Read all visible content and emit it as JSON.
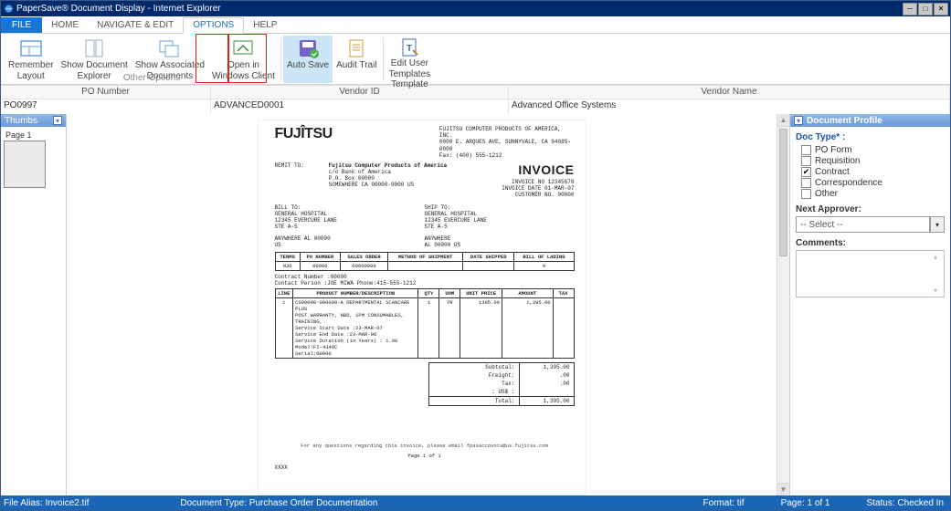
{
  "window": {
    "title": "PaperSave® Document Display - Internet Explorer"
  },
  "tabs": {
    "file": "FILE",
    "home": "HOME",
    "nav": "NAVIGATE & EDIT",
    "options": "OPTIONS",
    "help": "HELP"
  },
  "ribbon": {
    "remember_layout": "Remember\nLayout",
    "show_doc_explorer": "Show Document\nExplorer",
    "show_assoc": "Show Associated\nDocuments",
    "open_win": "Open in\nWindows Client",
    "auto_save": "Auto Save",
    "audit_trail": "Audit Trail",
    "edit_user": "Edit User\nTemplates\nTemplate",
    "other_options": "Other Options"
  },
  "header": {
    "po_label": "PO Number",
    "vid_label": "Vendor ID",
    "vname_label": "Vendor Name",
    "po": "PO0997",
    "vid": "ADVANCED0001",
    "vname": "Advanced Office Systems"
  },
  "thumbs": {
    "title": "Thumbs",
    "page1": "Page 1"
  },
  "profile": {
    "title": "Document Profile",
    "doc_type_label": "Doc Type* :",
    "opts": {
      "po_form": "PO Form",
      "requisition": "Requisition",
      "contract": "Contract",
      "correspondence": "Correspondence",
      "other": "Other"
    },
    "next_approver_label": "Next Approver:",
    "next_approver_value": "-- Select --",
    "comments_label": "Comments:"
  },
  "status": {
    "alias": "File Alias: Invoice2.tif",
    "doc_type": "Document Type: Purchase Order Documentation",
    "format": "Format: tif",
    "page": "Page: 1 of 1",
    "state": "Status: Checked In"
  },
  "invoice": {
    "company_line1": "FUJITSU COMPUTER PRODUCTS OF AMERICA, INC.",
    "company_line2": "0000 E. ARQUES AVE, SUNNYVALE, CA 94085-0000",
    "fax": "Fax: (408) 555-1212",
    "remit_label": "REMIT TO:",
    "remit1": "Fujitsu Computer Products of America",
    "remit2": "c/o Bank of America",
    "remit3": "P.O. Box 00000",
    "remit4": "SOMEWHERE CA 00000-0000 US",
    "invoice_word": "INVOICE",
    "invoice_no": "INVOICE NO  12345678",
    "invoice_date": "INVOICE DATE 01-MAR-07",
    "customer_no": "CUSTOMER NO. 00000",
    "billto_label": "BILL TO:",
    "shipto_label": "SHIP TO:",
    "bill1": "GENERAL HOSPITAL",
    "bill2": "12345 EVERCURE LANE",
    "bill3": "STE A-5",
    "bill4": "ANYWHERE AL 00000",
    "bill5": "US",
    "ship1": "ANYWHERE",
    "ship2": "AL 00000 US",
    "tbl1_h1": "TERMS",
    "tbl1_h2": "PO NUMBER",
    "tbl1_h3": "SALES ORDER",
    "tbl1_h4": "METHOD OF SHIPMENT",
    "tbl1_h5": "DATE SHIPPED",
    "tbl1_h6": "BILL OF LADING",
    "tbl1_r1": "N30",
    "tbl1_r2": "00000",
    "tbl1_r3": "00000000",
    "tbl1_r4": "",
    "tbl1_r5": "",
    "tbl1_r6": "0",
    "contract": "Contract Number :00000",
    "contact": "Contact Person :JOE MIWA   Phone:415-555-1212",
    "tbl2_h1": "LINE",
    "tbl2_h2": "PRODUCT NUMBER/DESCRIPTION",
    "tbl2_h3": "QTY",
    "tbl2_h4": "UOM",
    "tbl2_h5": "UNIT PRICE",
    "tbl2_h6": "AMOUNT",
    "tbl2_h7": "TAX",
    "desc1": "CG00000-000000-A DEPARTMENTAL SCANCARE PLUS",
    "desc2": "POST WARRANTY, NBD, 1PM CONSUMABLES, TRAINING,",
    "desc3": "Service Start Date :23-MAR-07",
    "desc4": "Service End Date :23-MAR-08",
    "desc5": "Service Duration (in Years) : 1.00",
    "desc6": "Model:FI-4340C",
    "desc7": "Serial:00000",
    "qty": "1",
    "uom": "YR",
    "unitprice": "1395.00",
    "amount": "1,395.00",
    "sub_label": "Subtotal:",
    "sub_val": "1,395.00",
    "freight_label": "Freight:",
    "freight_val": ".00",
    "tax_label": "Tax:",
    "tax_val": ".00",
    "cur_label": ": US$ :",
    "total_label": "Total:",
    "total_val": "1,395.00",
    "footer": "For any questions regarding this invoice, please email fpasaccounts@us.fujitsu.com",
    "pgfoot": "Page   1   of   1",
    "xxxx": "XXXX"
  }
}
